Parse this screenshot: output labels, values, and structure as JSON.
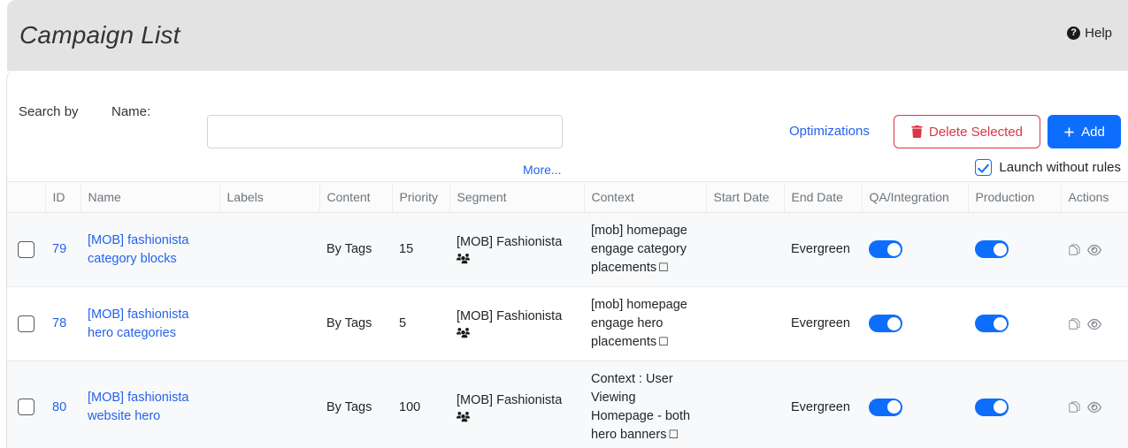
{
  "header": {
    "title": "Campaign List",
    "help_label": "Help",
    "help_icon": "question-circle-icon"
  },
  "search": {
    "search_by_label": "Search by",
    "name_label": "Name:",
    "name_value": "",
    "name_placeholder": "",
    "more_label": "More...",
    "optimizations_label": "Optimizations",
    "delete_label": "Delete Selected",
    "delete_icon": "trash-icon",
    "add_label": "Add",
    "add_icon": "plus-icon",
    "launch_label": "Launch without rules",
    "launch_checked": true
  },
  "colors": {
    "primary": "#0d6efd",
    "link": "#2563eb",
    "danger": "#dc3545",
    "header_band": "#e3e3e3",
    "toggle_on": "#0d6efd"
  },
  "table": {
    "columns": [
      "",
      "ID",
      "Name",
      "Labels",
      "Content",
      "Priority",
      "Segment",
      "Context",
      "Start Date",
      "End Date",
      "QA/Integration",
      "Production",
      "Actions"
    ],
    "rows": [
      {
        "selected": false,
        "id": "79",
        "name": "[MOB] fashionista category blocks",
        "labels": "",
        "content": "By Tags",
        "priority": "15",
        "segment": "[MOB] Fashionista",
        "segment_icon": "users-group-icon",
        "context": "[mob] homepage engage category placements",
        "context_box": "☐",
        "start_date": "",
        "end_date": "Evergreen",
        "qa_integration": true,
        "production": true,
        "actions": [
          "copy-icon",
          "eye-icon"
        ]
      },
      {
        "selected": false,
        "id": "78",
        "name": "[MOB] fashionista hero categories",
        "labels": "",
        "content": "By Tags",
        "priority": "5",
        "segment": "[MOB] Fashionista",
        "segment_icon": "users-group-icon",
        "context": "[mob] homepage engage hero placements",
        "context_box": "☐",
        "start_date": "",
        "end_date": "Evergreen",
        "qa_integration": true,
        "production": true,
        "actions": [
          "copy-icon",
          "eye-icon"
        ]
      },
      {
        "selected": false,
        "id": "80",
        "name": "[MOB] fashionista website hero",
        "labels": "",
        "content": "By Tags",
        "priority": "100",
        "segment": "[MOB] Fashionista",
        "segment_icon": "users-group-icon",
        "context": "Context : User Viewing Homepage - both hero banners",
        "context_box": "☐",
        "start_date": "",
        "end_date": "Evergreen",
        "qa_integration": true,
        "production": true,
        "actions": [
          "copy-icon",
          "eye-icon"
        ]
      }
    ]
  }
}
